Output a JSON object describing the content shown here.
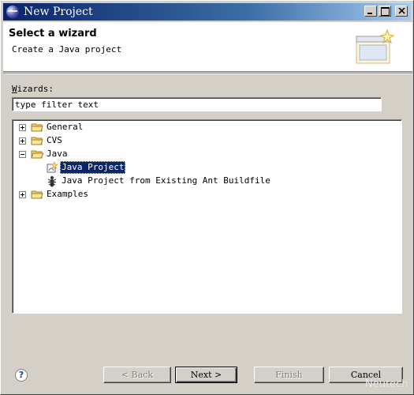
{
  "window": {
    "title": "New Project"
  },
  "header": {
    "title": "Select a wizard",
    "description": "Create a Java project"
  },
  "wizards": {
    "label_underlined": "W",
    "label_rest": "izards:",
    "filter_value": "type filter text"
  },
  "tree": {
    "nodes": [
      {
        "label": "General",
        "expanded": false
      },
      {
        "label": "CVS",
        "expanded": false
      },
      {
        "label": "Java",
        "expanded": true,
        "children": [
          {
            "label": "Java Project",
            "selected": true,
            "icon": "java-project-icon"
          },
          {
            "label": "Java Project from Existing Ant Buildfile",
            "icon": "ant-icon"
          }
        ]
      },
      {
        "label": "Examples",
        "expanded": false
      }
    ]
  },
  "buttons": {
    "help": "?",
    "back": "< Back",
    "next": "Next >",
    "finish": "Finish",
    "cancel": "Cancel"
  },
  "watermark": "Neutech",
  "colors": {
    "title_bar": "#0a246a",
    "selection": "#0a246a",
    "dialog_bg": "#d4d0c8"
  }
}
